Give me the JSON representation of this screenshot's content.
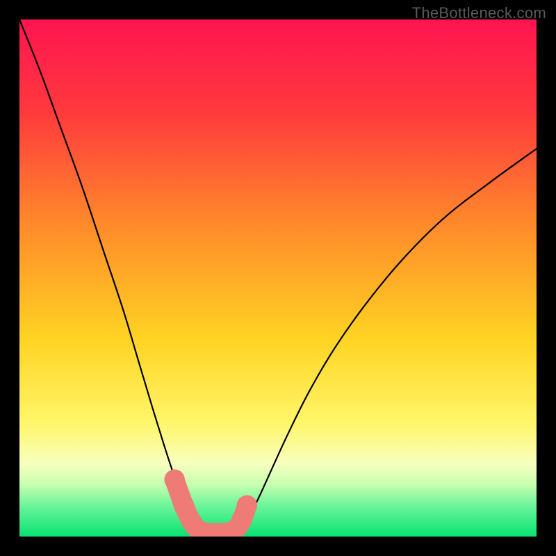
{
  "watermark": "TheBottleneck.com",
  "chart_data": {
    "type": "line",
    "title": "",
    "xlabel": "",
    "ylabel": "",
    "xlim": [
      0,
      100
    ],
    "ylim": [
      0,
      100
    ],
    "background_gradient_stops": [
      {
        "pct": 0,
        "color": "#ff1450"
      },
      {
        "pct": 18,
        "color": "#ff3a3d"
      },
      {
        "pct": 40,
        "color": "#ff8b2a"
      },
      {
        "pct": 62,
        "color": "#ffd423"
      },
      {
        "pct": 78,
        "color": "#fff66a"
      },
      {
        "pct": 86,
        "color": "#f6ffbf"
      },
      {
        "pct": 90,
        "color": "#c6ffb0"
      },
      {
        "pct": 94,
        "color": "#6cf59a"
      },
      {
        "pct": 100,
        "color": "#08e272"
      }
    ],
    "series": [
      {
        "name": "left-curve",
        "x": [
          0.0,
          4.0,
          8.0,
          12.0,
          16.0,
          20.0,
          23.0,
          26.0,
          28.5,
          30.5,
          32.0,
          33.2,
          34.2,
          35.0
        ],
        "y": [
          100.0,
          90.0,
          79.0,
          68.0,
          56.0,
          44.0,
          34.0,
          24.0,
          16.0,
          10.0,
          5.5,
          2.8,
          1.2,
          0.6
        ]
      },
      {
        "name": "right-curve",
        "x": [
          42.0,
          43.0,
          44.5,
          46.5,
          49.0,
          52.0,
          56.0,
          61.0,
          67.0,
          74.0,
          82.0,
          91.0,
          100.0
        ],
        "y": [
          0.6,
          1.6,
          4.0,
          8.0,
          13.5,
          20.0,
          28.0,
          36.5,
          45.0,
          53.5,
          61.5,
          68.5,
          75.0
        ]
      }
    ],
    "floor_band": {
      "name": "optimal-zone",
      "color": "#ee7b76",
      "points_x": [
        30.0,
        31.8,
        33.2,
        34.5,
        36.0,
        38.0,
        40.0,
        41.8,
        43.0,
        44.0
      ],
      "points_y": [
        11.0,
        6.0,
        3.0,
        1.4,
        0.8,
        0.7,
        0.8,
        1.4,
        3.2,
        6.0
      ],
      "dot_radius_pct": 1.9
    }
  }
}
